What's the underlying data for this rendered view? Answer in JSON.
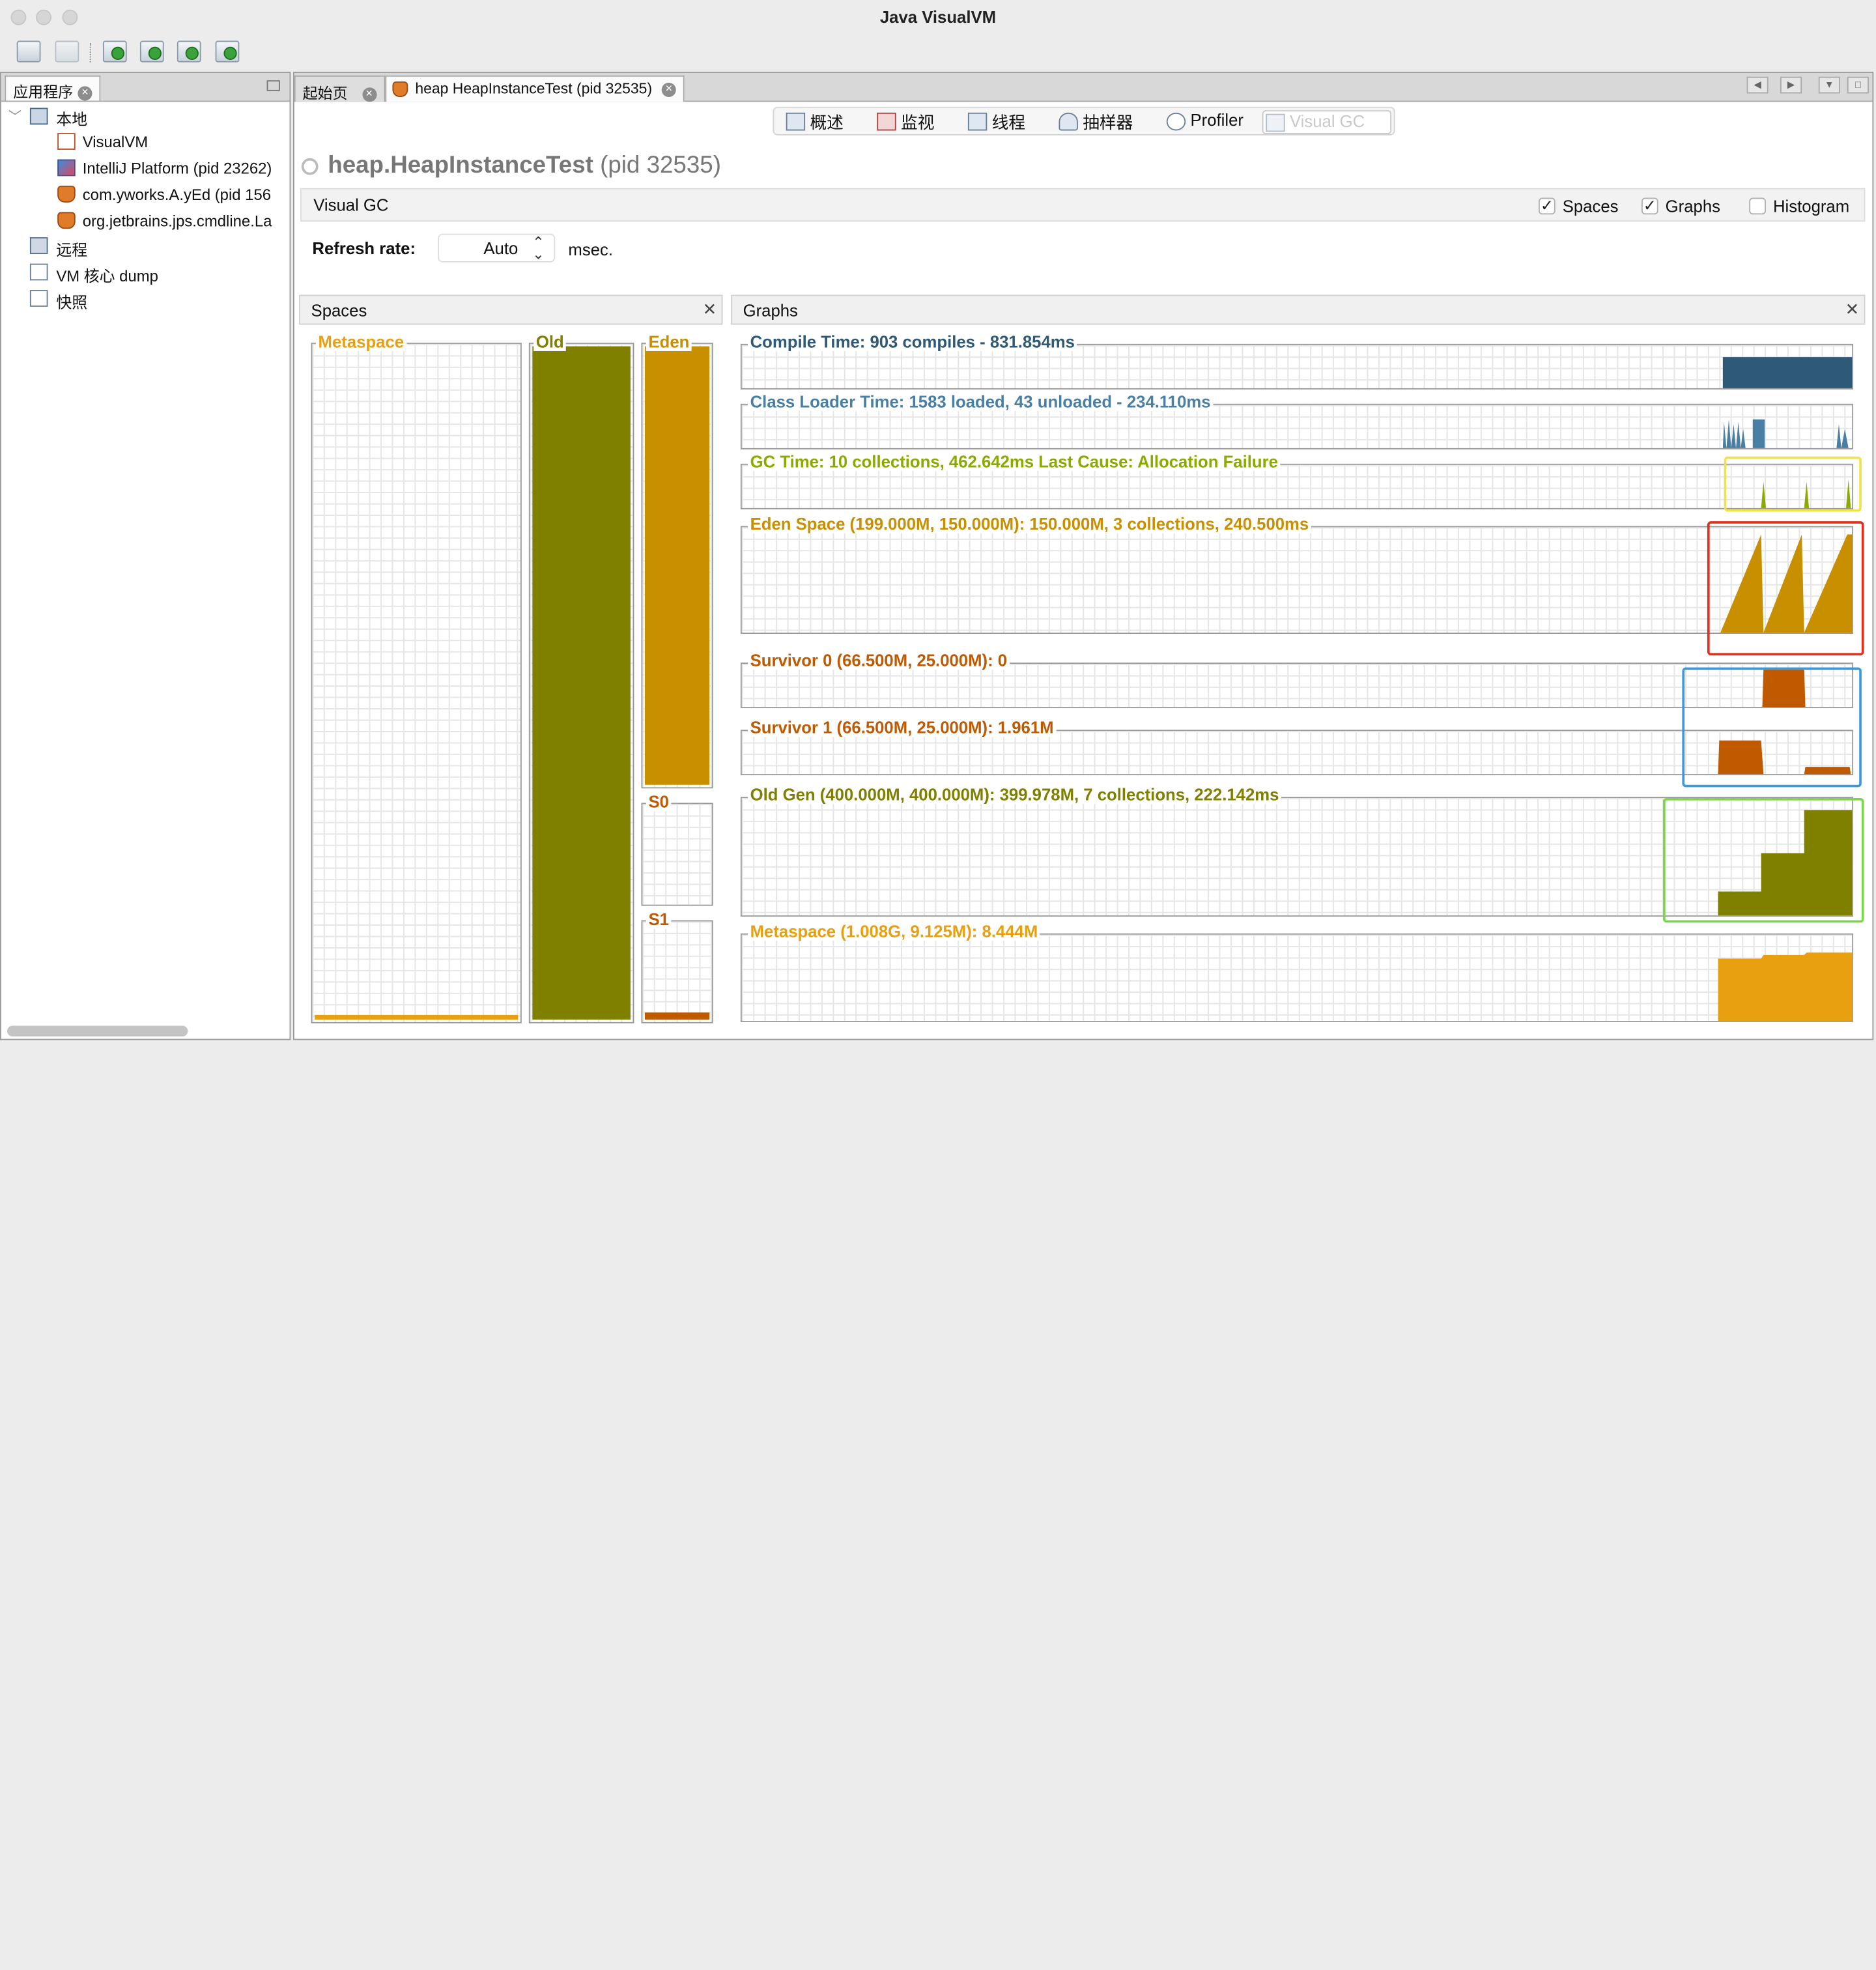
{
  "window": {
    "title": "Java VisualVM"
  },
  "toolbar": {
    "icons": [
      "open-icon",
      "save-icon",
      "add-jmx-connection-icon",
      "add-remote-host-icon",
      "add-core-dump-icon",
      "add-snapshot-icon"
    ]
  },
  "left_panel": {
    "tab_label": "应用程序",
    "tree": {
      "local": "本地",
      "items": [
        "VisualVM",
        "IntelliJ Platform (pid 23262)",
        "com.yworks.A.yEd (pid 156",
        "org.jetbrains.jps.cmdline.La"
      ],
      "remote": "远程",
      "vm_dump": "VM 核心 dump",
      "snapshots": "快照"
    }
  },
  "editor_tabs": [
    {
      "label": "起始页"
    },
    {
      "label": "heap HeapInstanceTest (pid 32535)"
    }
  ],
  "subtabs": [
    "概述",
    "监视",
    "线程",
    "抽样器",
    "Profiler",
    "Visual GC"
  ],
  "process": {
    "name": "heap.HeapInstanceTest",
    "pid_text": "(pid 32535)"
  },
  "visual_gc": {
    "title": "Visual GC",
    "options": [
      {
        "label": "Spaces",
        "checked": true
      },
      {
        "label": "Graphs",
        "checked": true
      },
      {
        "label": "Histogram",
        "checked": false
      }
    ],
    "refresh_label": "Refresh rate:",
    "refresh_value": "Auto",
    "refresh_unit": "msec."
  },
  "spaces_panel": {
    "title": "Spaces",
    "metaspace": {
      "label": "Metaspace",
      "fill": 0.008,
      "color": "#E8A010"
    },
    "old": {
      "label": "Old",
      "fill": 1.0,
      "color": "#7F7F00"
    },
    "eden": {
      "label": "Eden",
      "fill": 1.0,
      "color": "#C89000"
    },
    "s0": {
      "label": "S0",
      "fill": 0.0,
      "color": "#C05A00"
    },
    "s1": {
      "label": "S1",
      "fill": 0.08,
      "color": "#C05A00"
    }
  },
  "graphs_panel": {
    "title": "Graphs",
    "graphs": [
      {
        "label": "Compile Time: 903 compiles - 831.854ms",
        "color": "#2E5A78"
      },
      {
        "label": "Class Loader Time: 1583 loaded, 43 unloaded - 234.110ms",
        "color": "#4A7FA4"
      },
      {
        "label": "GC Time: 10 collections, 462.642ms Last Cause: Allocation Failure",
        "color": "#8AAA00"
      },
      {
        "label": "Eden Space (199.000M, 150.000M): 150.000M, 3 collections, 240.500ms",
        "color": "#C89000"
      },
      {
        "label": "Survivor 0 (66.500M, 25.000M): 0",
        "color": "#C05A00"
      },
      {
        "label": "Survivor 1 (66.500M, 25.000M): 1.961M",
        "color": "#C05A00"
      },
      {
        "label": "Old Gen (400.000M, 400.000M): 399.978M, 7 collections, 222.142ms",
        "color": "#7F7F00"
      },
      {
        "label": "Metaspace (1.008G, 9.125M): 8.444M",
        "color": "#E8A010"
      }
    ],
    "highlight_colors": {
      "gc": "#F2E24A",
      "eden": "#E0301E",
      "survivor": "#3A9AE0",
      "old": "#7CD848"
    }
  }
}
